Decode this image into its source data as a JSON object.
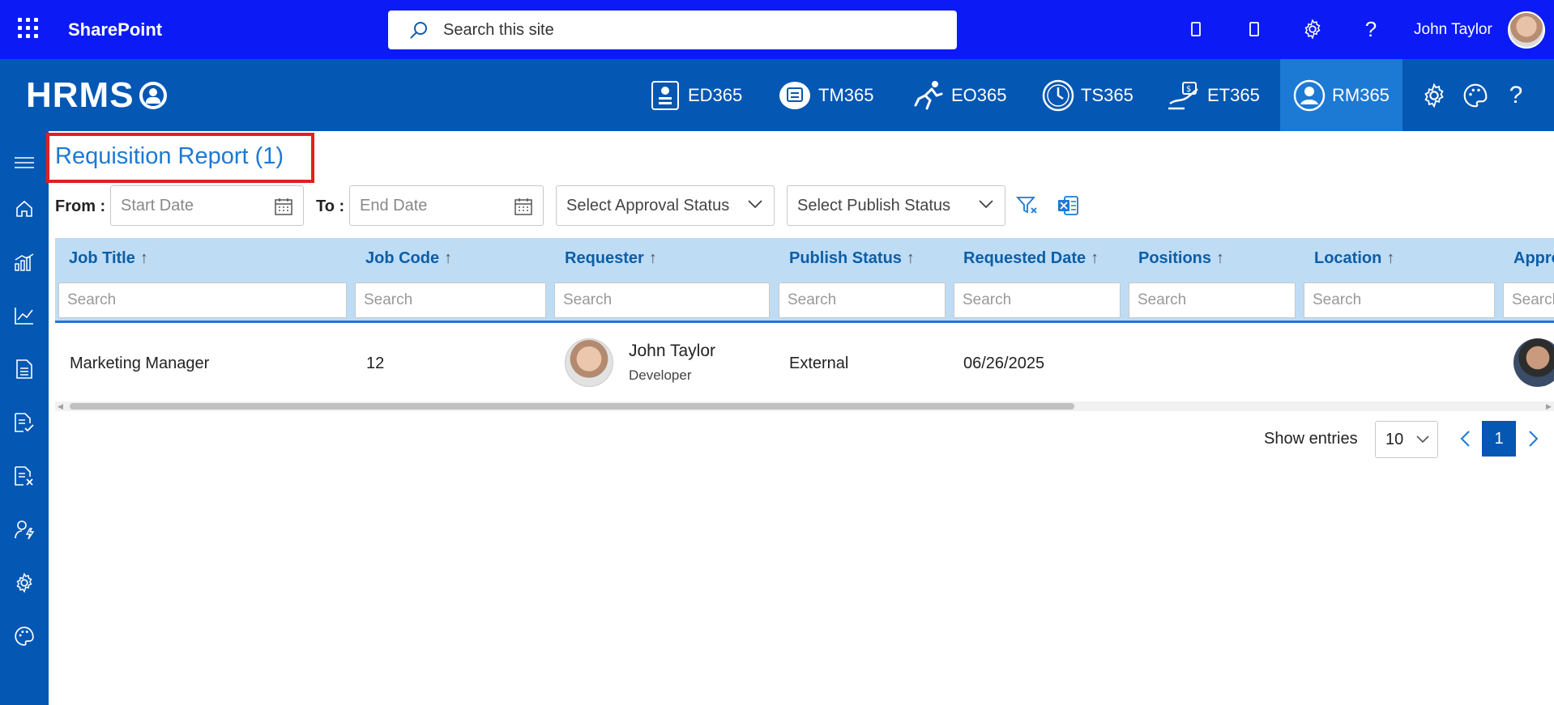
{
  "suite": {
    "brand": "SharePoint",
    "search_placeholder": "Search this site",
    "user_name": "John Taylor"
  },
  "app": {
    "logo_text": "HRMS",
    "modules": [
      {
        "label": "ED365",
        "icon": "employee-directory-icon"
      },
      {
        "label": "TM365",
        "icon": "task-management-icon"
      },
      {
        "label": "EO365",
        "icon": "onboarding-icon"
      },
      {
        "label": "TS365",
        "icon": "timesheet-icon"
      },
      {
        "label": "ET365",
        "icon": "expense-icon"
      },
      {
        "label": "RM365",
        "icon": "recruitment-icon",
        "active": true
      }
    ]
  },
  "page": {
    "title": "Requisition Report (1)"
  },
  "filters": {
    "from_label": "From :",
    "start_placeholder": "Start Date",
    "to_label": "To :",
    "end_placeholder": "End Date",
    "approval_status": "Select Approval Status",
    "publish_status": "Select Publish Status"
  },
  "grid": {
    "sort_arrow": "↑",
    "search_placeholder": "Search",
    "columns": [
      "Job Title",
      "Job Code",
      "Requester",
      "Publish Status",
      "Requested Date",
      "Positions",
      "Location",
      "Appro"
    ],
    "rows": [
      {
        "job_title": "Marketing Manager",
        "job_code": "12",
        "requester_name": "John Taylor",
        "requester_role": "Developer",
        "publish_status": "External",
        "requested_date": "06/26/2025",
        "positions": "",
        "location": ""
      }
    ]
  },
  "pagination": {
    "show_entries_label": "Show entries",
    "page_size": "10",
    "current_page": "1"
  },
  "colors": {
    "suite_bar": "#0c1bf5",
    "app_bar": "#0457b3",
    "active_module": "#1c79d4",
    "header_row": "#bfdcf5",
    "title_highlight": "#e31e1e"
  }
}
